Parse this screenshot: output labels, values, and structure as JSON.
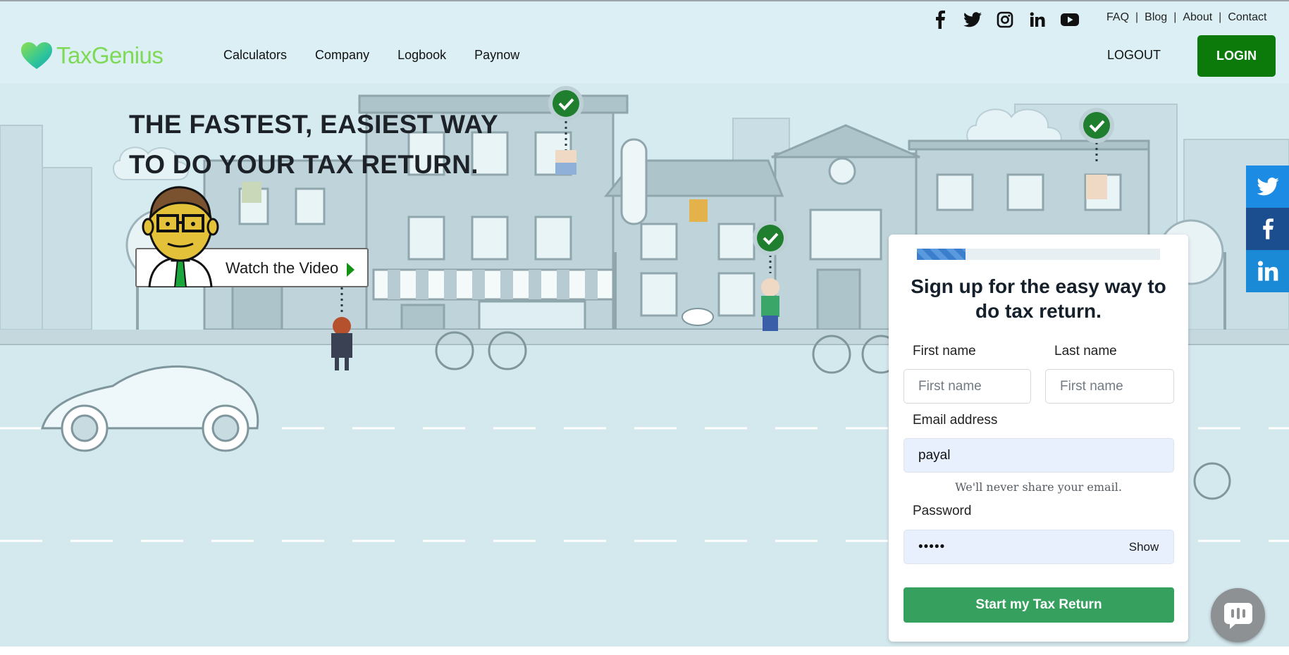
{
  "header": {
    "social_icons": [
      "facebook-icon",
      "twitter-icon",
      "instagram-icon",
      "linkedin-icon",
      "youtube-icon"
    ],
    "top_links": [
      "FAQ",
      "Blog",
      "About",
      "Contact"
    ],
    "top_link_separator": "|",
    "logo_text": "TaxGenius",
    "nav": [
      "Calculators",
      "Company",
      "Logbook",
      "Paynow"
    ],
    "logout_label": "LOGOUT",
    "login_label": "LOGIN"
  },
  "hero": {
    "headline_line1": "THE FASTEST, EASIEST WAY",
    "headline_line2": "TO DO YOUR TAX RETURN.",
    "watch_video_label": "Watch the Video"
  },
  "share_bar": [
    "twitter-icon",
    "facebook-icon",
    "linkedin-icon"
  ],
  "signup": {
    "progress": 0.2,
    "title": "Sign up for the easy way to do tax return.",
    "first_name_label": "First name",
    "first_name_placeholder": "First name",
    "last_name_label": "Last name",
    "last_name_placeholder": "First name",
    "email_label": "Email address",
    "email_value": "payal",
    "email_help": "We'll never share your email.",
    "password_label": "Password",
    "password_value": "•••••",
    "show_label": "Show",
    "submit_label": "Start my Tax Return"
  },
  "colors": {
    "brand_green": "#7ed957",
    "login_green": "#0b7a0b",
    "submit_green": "#36a05f",
    "background": "#d8edf2"
  }
}
